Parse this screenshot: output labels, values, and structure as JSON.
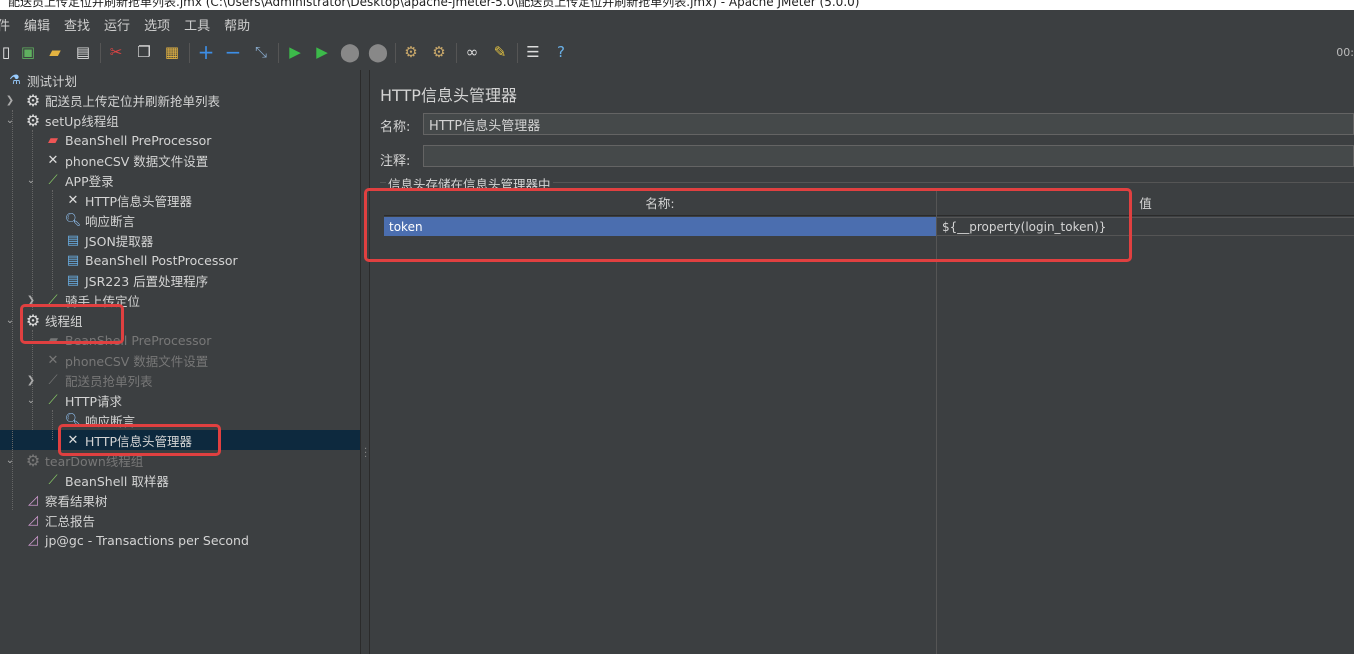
{
  "window": {
    "title": "配送员上传定位并刷新抢单列表.jmx (C:\\Users\\Administrator\\Desktop\\apache-jmeter-5.0\\配送员上传定位并刷新抢单列表.jmx) - Apache JMeter (5.0.0)"
  },
  "menu": [
    "件",
    "编辑",
    "查找",
    "运行",
    "选项",
    "工具",
    "帮助"
  ],
  "toolbar": {
    "timer": "00:",
    "icons": [
      "new-icon",
      "templates-icon",
      "open-icon",
      "save-icon",
      "cut-icon",
      "copy-icon",
      "paste-icon",
      "expand-icon",
      "collapse-icon",
      "toggle-icon",
      "start-icon",
      "start-no-pause-icon",
      "stop-icon",
      "shutdown-icon",
      "clear-icon",
      "clear-all-icon",
      "search-icon",
      "reset-search-icon",
      "function-helper-icon",
      "help-icon"
    ]
  },
  "tree": {
    "nodes": [
      {
        "label": "测试计划",
        "icon": "test-plan-icon",
        "disabled": false
      },
      {
        "label": "配送员上传定位并刷新抢单列表",
        "icon": "gear-icon",
        "disabled": false
      },
      {
        "label": "setUp线程组",
        "icon": "gear-icon",
        "disabled": false
      },
      {
        "label": "BeanShell PreProcessor",
        "icon": "preprocessor-icon",
        "disabled": false
      },
      {
        "label": "phoneCSV 数据文件设置",
        "icon": "config-tools-icon",
        "disabled": false
      },
      {
        "label": "APP登录",
        "icon": "sampler-pipette-icon",
        "disabled": false
      },
      {
        "label": "HTTP信息头管理器",
        "icon": "config-tools-icon",
        "disabled": false
      },
      {
        "label": "响应断言",
        "icon": "magnifier-icon",
        "disabled": false
      },
      {
        "label": "JSON提取器",
        "icon": "postprocessor-icon",
        "disabled": false
      },
      {
        "label": "BeanShell PostProcessor",
        "icon": "postprocessor-icon",
        "disabled": false
      },
      {
        "label": "JSR223 后置处理程序",
        "icon": "postprocessor-icon",
        "disabled": false
      },
      {
        "label": "骑手上传定位",
        "icon": "sampler-pipette-icon",
        "disabled": false
      },
      {
        "label": "线程组",
        "icon": "gear-icon",
        "disabled": false
      },
      {
        "label": "BeanShell PreProcessor",
        "icon": "preprocessor-icon",
        "disabled": true
      },
      {
        "label": "phoneCSV 数据文件设置",
        "icon": "config-tools-icon",
        "disabled": true
      },
      {
        "label": "配送员抢单列表",
        "icon": "sampler-pipette-icon",
        "disabled": true
      },
      {
        "label": "HTTP请求",
        "icon": "sampler-pipette-icon",
        "disabled": false
      },
      {
        "label": "响应断言",
        "icon": "magnifier-icon",
        "disabled": false
      },
      {
        "label": "HTTP信息头管理器",
        "icon": "config-tools-icon",
        "disabled": false
      },
      {
        "label": "tearDown线程组",
        "icon": "gear-icon",
        "disabled": true
      },
      {
        "label": "BeanShell 取样器",
        "icon": "sampler-pipette-icon",
        "disabled": false
      },
      {
        "label": "察看结果树",
        "icon": "listener-chart-icon",
        "disabled": false
      },
      {
        "label": "汇总报告",
        "icon": "listener-chart-icon",
        "disabled": false
      },
      {
        "label": "jp@gc - Transactions per Second",
        "icon": "listener-chart-icon",
        "disabled": false
      }
    ]
  },
  "panel": {
    "title": "HTTP信息头管理器",
    "name_label": "名称:",
    "name_value": "HTTP信息头管理器",
    "comment_label": "注释:",
    "comment_value": "",
    "group_label": "信息头存储在信息头管理器中",
    "table": {
      "headers": [
        "名称:",
        "值"
      ],
      "rows": [
        {
          "name": "token",
          "value": "${__property(login_token)}"
        }
      ]
    }
  },
  "colors": {
    "background": "#3c3f41",
    "selection": "#4b6eaf",
    "tree_selection": "#0d293e",
    "highlight": "#e04040"
  }
}
